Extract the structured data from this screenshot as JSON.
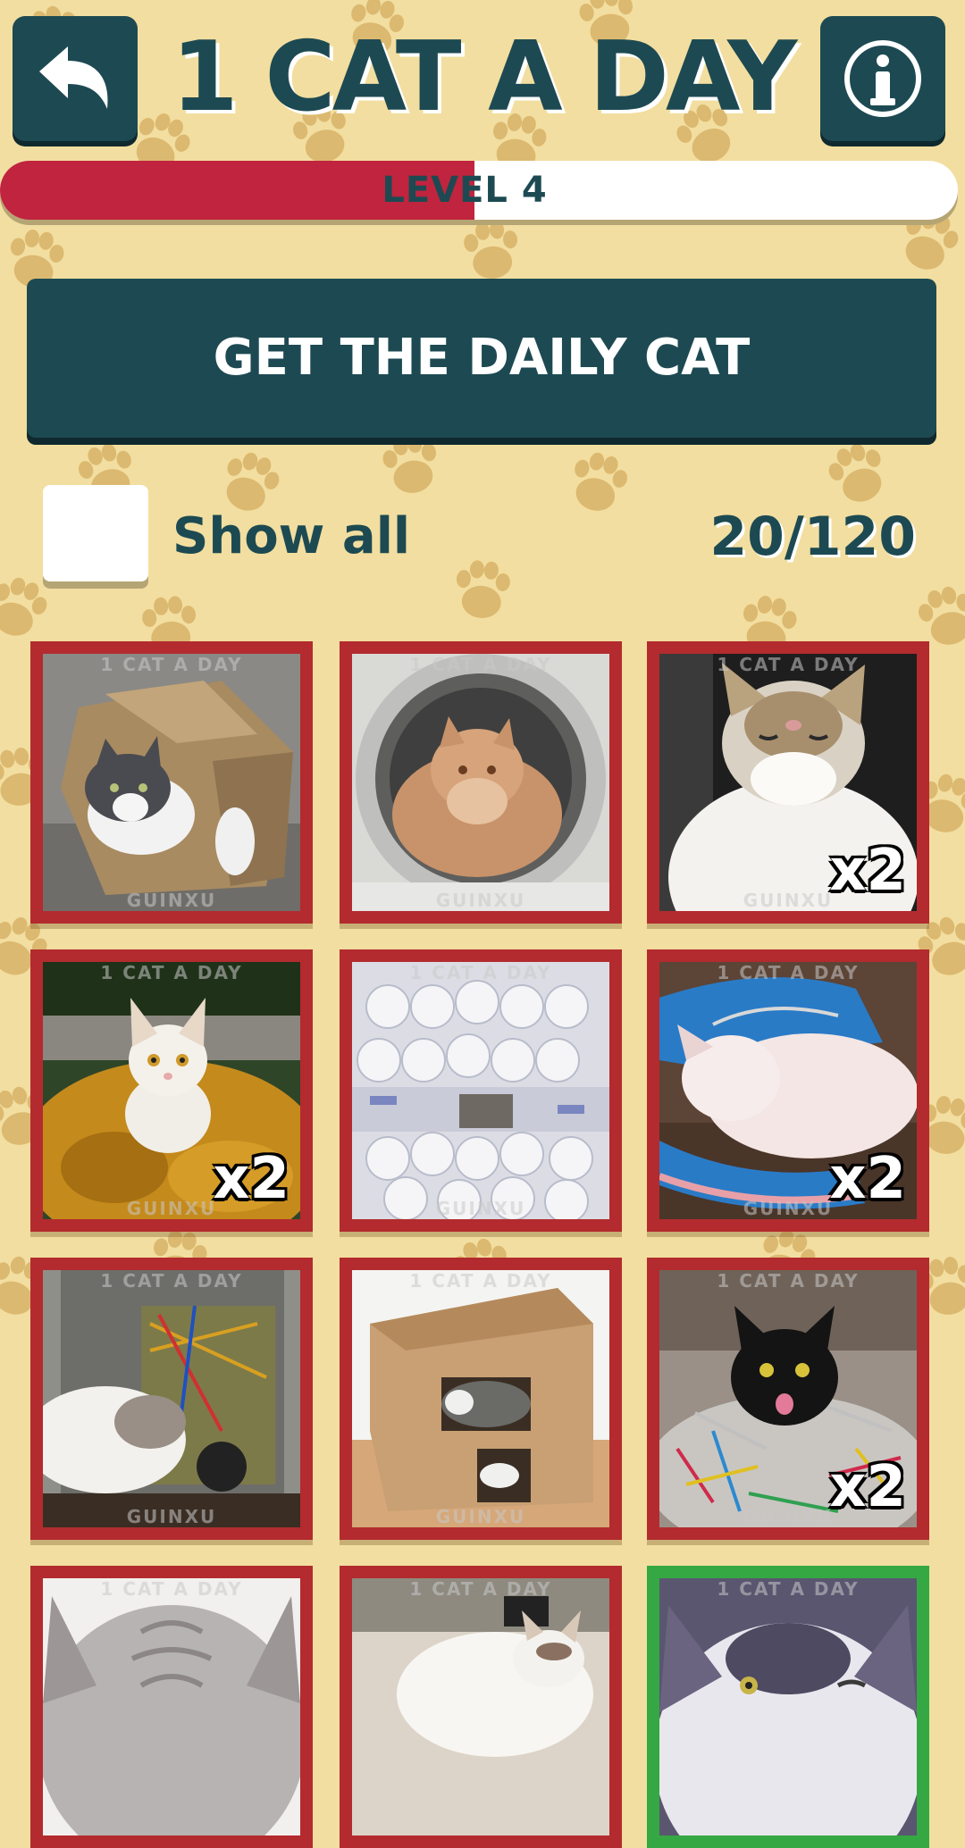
{
  "header": {
    "title": "1 CAT A DAY",
    "back_icon": "back-arrow-icon",
    "info_icon": "info-icon"
  },
  "level": {
    "label": "LEVEL 4",
    "progress_percent": 49.5
  },
  "daily_button": {
    "label": "GET THE DAILY CAT"
  },
  "filter": {
    "show_all_label": "Show all",
    "show_all_checked": false,
    "count": "20/120"
  },
  "watermark": {
    "top": "1 CAT A DAY",
    "bottom": "GUINXU"
  },
  "grid": {
    "tiles": [
      {
        "subject": "gray-white cat in paper bag",
        "badge": ""
      },
      {
        "subject": "fluffy kitten in washing machine",
        "badge": ""
      },
      {
        "subject": "cat with eyes closed",
        "badge": "x2"
      },
      {
        "subject": "white cat in autumn leaves",
        "badge": "x2"
      },
      {
        "subject": "cat behind toilet paper rolls",
        "badge": ""
      },
      {
        "subject": "white kitten in sneaker",
        "badge": "x2"
      },
      {
        "subject": "cat inside computer",
        "badge": ""
      },
      {
        "subject": "cat in cardboard box",
        "badge": ""
      },
      {
        "subject": "black cat in tinsel",
        "badge": "x2"
      },
      {
        "subject": "gray tabby cat close-up",
        "badge": ""
      },
      {
        "subject": "white cat on desk",
        "badge": ""
      },
      {
        "subject": "cat winking close-up",
        "badge": ""
      }
    ]
  },
  "colors": {
    "background": "#f2dea0",
    "primary": "#1d4a52",
    "level_fill": "#c0243e",
    "tile_frame": "#b32b2e",
    "tile_frame_selected": "#35a843"
  }
}
